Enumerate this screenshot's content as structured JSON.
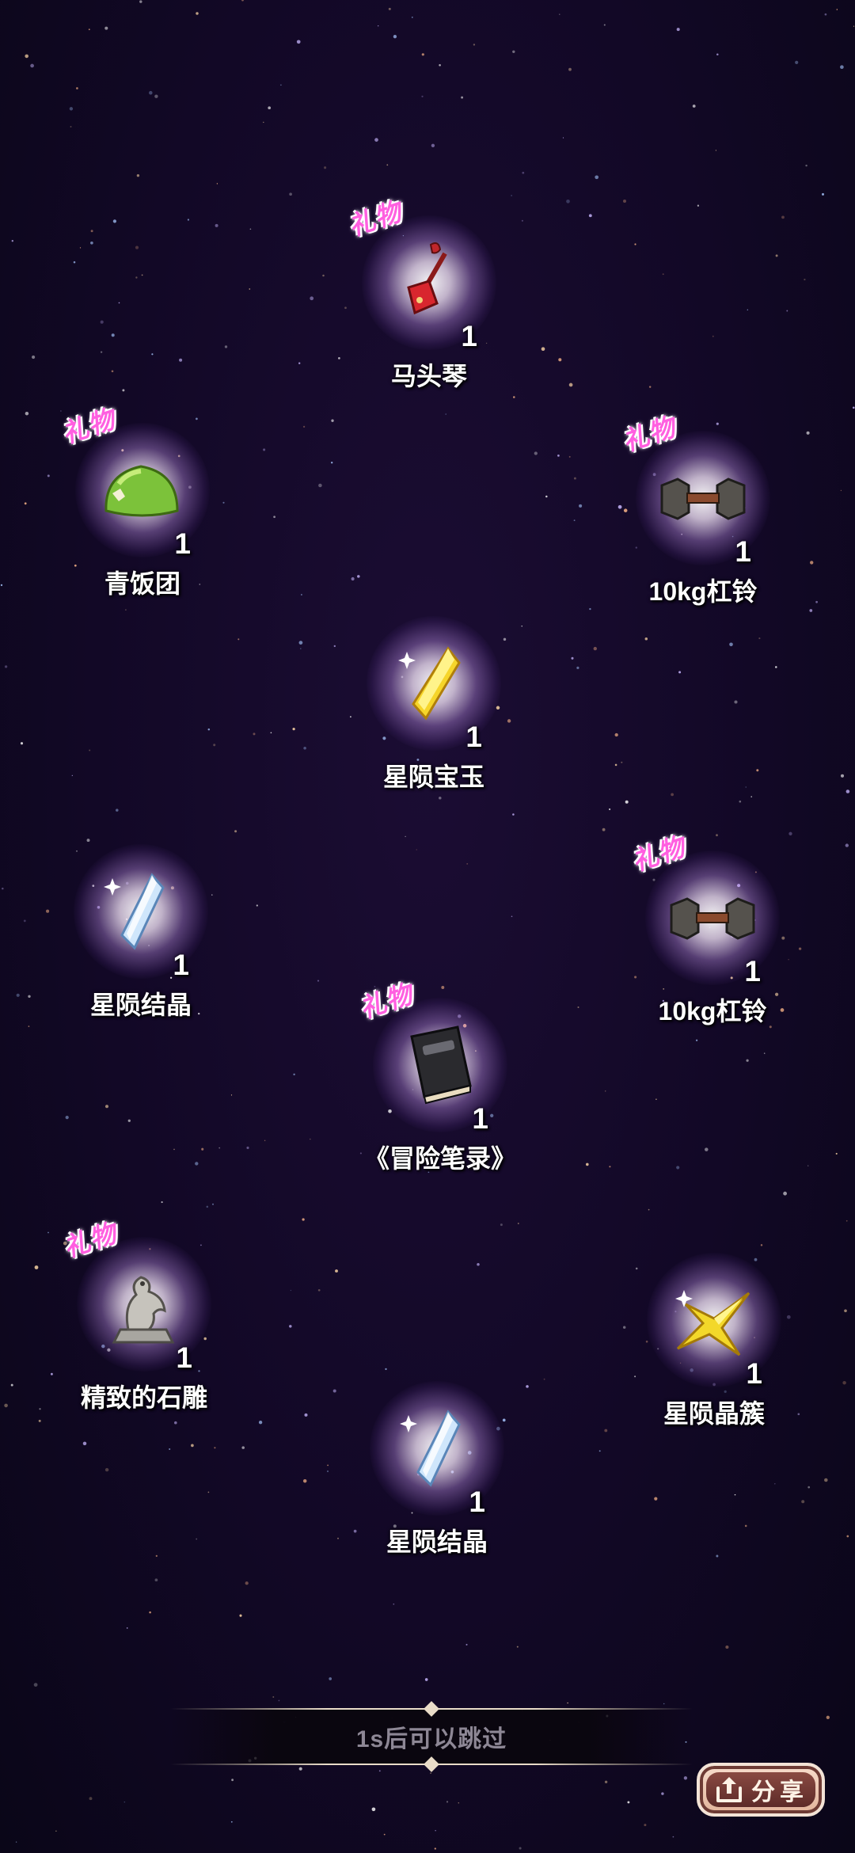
{
  "gift_tag": "礼物",
  "items": [
    {
      "name": "马头琴",
      "count": "1",
      "gift": true,
      "icon": "horsehead-fiddle-icon"
    },
    {
      "name": "青饭团",
      "count": "1",
      "gift": true,
      "icon": "green-riceball-icon"
    },
    {
      "name": "10kg杠铃",
      "count": "1",
      "gift": true,
      "icon": "dumbbell-icon"
    },
    {
      "name": "星陨宝玉",
      "count": "1",
      "gift": false,
      "icon": "yellow-gem-icon"
    },
    {
      "name": "星陨结晶",
      "count": "1",
      "gift": false,
      "icon": "blue-crystal-icon"
    },
    {
      "name": "10kg杠铃",
      "count": "1",
      "gift": true,
      "icon": "dumbbell-icon"
    },
    {
      "name": "《冒险笔录》",
      "count": "1",
      "gift": true,
      "icon": "black-book-icon"
    },
    {
      "name": "精致的石雕",
      "count": "1",
      "gift": true,
      "icon": "stone-statue-icon"
    },
    {
      "name": "星陨晶簇",
      "count": "1",
      "gift": false,
      "icon": "yellow-star-crystal-icon"
    },
    {
      "name": "星陨结晶",
      "count": "1",
      "gift": false,
      "icon": "blue-crystal-icon"
    }
  ],
  "skip_bar": {
    "text": "1s后可以跳过"
  },
  "share_button": {
    "label": "分享",
    "icon": "share-icon"
  },
  "colors": {
    "background": "#120826",
    "gift_tag": "#ff5fe0",
    "share_button": "#e2b49b"
  }
}
